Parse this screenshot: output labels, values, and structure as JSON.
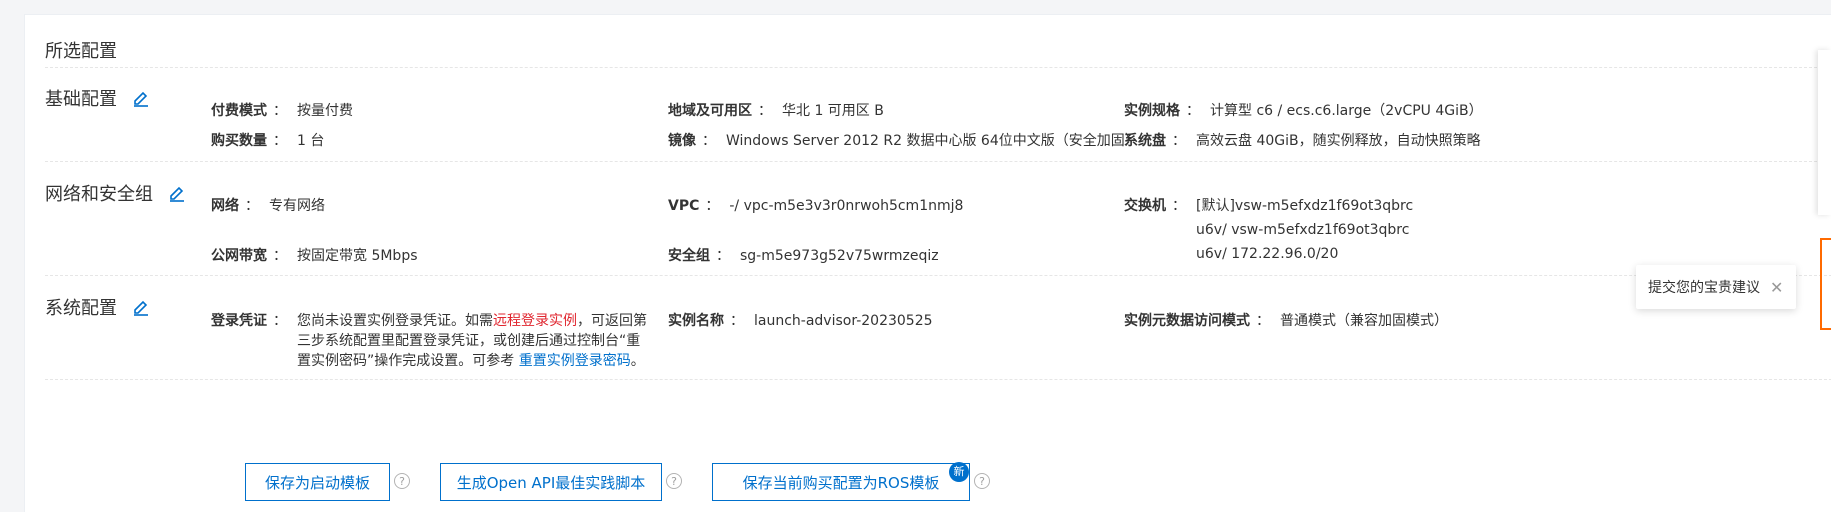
{
  "title": "所选配置",
  "sections": {
    "basic": {
      "name": "基础配置",
      "billing": {
        "label": "付费模式",
        "value": "按量付费"
      },
      "region": {
        "label": "地域及可用区",
        "value": "华北 1 可用区 B"
      },
      "instance_type": {
        "label": "实例规格",
        "value": "计算型 c6 / ecs.c6.large（2vCPU 4GiB）"
      },
      "quantity": {
        "label": "购买数量",
        "value": "1 台"
      },
      "image": {
        "label": "镜像",
        "value": "Windows Server 2012 R2 数据中心版 64位中文版（安全加固）"
      },
      "system_disk": {
        "label": "系统盘",
        "value": "高效云盘 40GiB，随实例释放，自动快照策略"
      }
    },
    "network": {
      "name": "网络和安全组",
      "network_type": {
        "label": "网络",
        "value": "专有网络"
      },
      "vpc": {
        "label": "VPC",
        "value": "-/ vpc-m5e3v3r0nrwoh5cm1nmj8"
      },
      "vswitch": {
        "label": "交换机",
        "value": "[默认]vsw-m5efxdz1f69ot3qbrcu6v/ vsw-m5efxdz1f69ot3qbrcu6v/ 172.22.96.0/20"
      },
      "bandwidth": {
        "label": "公网带宽",
        "value": "按固定带宽 5Mbps"
      },
      "security_group": {
        "label": "安全组",
        "value": "sg-m5e973g52v75wrmzeqiz"
      }
    },
    "system": {
      "name": "系统配置",
      "login": {
        "label": "登录凭证",
        "text1": "您尚未设置实例登录凭证。如需",
        "red_link": "远程登录实例",
        "text2": "，可返回第三步系统配置里配置登录凭证，或创建后通过控制台“重置实例密码”操作完成设置。可参考 ",
        "blue_link": "重置实例登录密码",
        "text3": "。"
      },
      "instance_name": {
        "label": "实例名称",
        "value": "launch-advisor-20230525"
      },
      "metadata": {
        "label": "实例元数据访问模式",
        "value": "普通模式（兼容加固模式）"
      }
    }
  },
  "buttons": {
    "save_template": "保存为启动模板",
    "gen_openapi": "生成Open API最佳实践脚本",
    "save_ros": "保存当前购买配置为ROS模板",
    "new_badge": "新",
    "help": "?"
  },
  "separator": "：",
  "feedback": {
    "text": "提交您的宝贵建议",
    "close": "✕"
  },
  "colors": {
    "accent": "#0070cc",
    "red_link": "#e0262f",
    "orange": "#ff6a00"
  }
}
